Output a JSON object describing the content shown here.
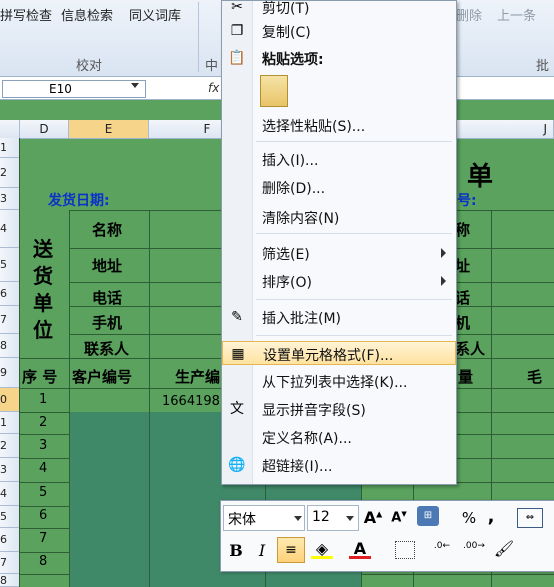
{
  "ribbon": {
    "items": [
      "拼写检查",
      "信息检索",
      "同义词库"
    ],
    "group_proofing": "校对",
    "group_partial": "中",
    "right_items": [
      "删除",
      "上一条"
    ],
    "right_group_partial": "批"
  },
  "formula_bar": {
    "name_box": "E10",
    "fx": "fx"
  },
  "columns": [
    "D",
    "E",
    "F",
    "J"
  ],
  "rows": [
    "1",
    "2",
    "3",
    "4",
    "5",
    "6",
    "7",
    "8",
    "9",
    "0",
    "1",
    "2",
    "3",
    "4",
    "5",
    "6",
    "7",
    "8",
    "9"
  ],
  "sheet": {
    "title_char": "单",
    "ship_date": "发货日期:",
    "right_header_partial": "号:",
    "vertical_label": [
      "送",
      "货",
      "单",
      "位"
    ],
    "fields": [
      "名称",
      "地址",
      "电话",
      "手机",
      "联系人"
    ],
    "right_fields": [
      "称",
      "址",
      "话",
      "机",
      "系人"
    ],
    "table_headers": [
      "序 号",
      "客户编号",
      "生产编"
    ],
    "right_table_headers": [
      "量",
      "毛"
    ],
    "serials": [
      "1",
      "2",
      "3",
      "4",
      "5",
      "6",
      "7",
      "8"
    ],
    "partial_value": "1664198"
  },
  "context_menu": {
    "items": [
      {
        "label": "剪切(T)",
        "icon": "scissors-icon"
      },
      {
        "label": "复制(C)",
        "icon": "copy-icon"
      },
      {
        "label": "粘贴选项:",
        "icon": "paste-icon",
        "bold": true
      },
      {
        "label": "",
        "icon": "paste-option-icon"
      },
      {
        "label": "选择性粘贴(S)...",
        "icon": ""
      },
      {
        "label": "插入(I)...",
        "icon": ""
      },
      {
        "label": "删除(D)...",
        "icon": ""
      },
      {
        "label": "清除内容(N)",
        "icon": ""
      },
      {
        "label": "筛选(E)",
        "icon": "",
        "submenu": true
      },
      {
        "label": "排序(O)",
        "icon": "",
        "submenu": true
      },
      {
        "label": "插入批注(M)",
        "icon": "comment-icon"
      },
      {
        "label": "设置单元格格式(F)...",
        "icon": "format-cells-icon",
        "highlighted": true
      },
      {
        "label": "从下拉列表中选择(K)...",
        "icon": ""
      },
      {
        "label": "显示拼音字段(S)",
        "icon": "phonetic-icon"
      },
      {
        "label": "定义名称(A)...",
        "icon": ""
      },
      {
        "label": "超链接(I)...",
        "icon": "hyperlink-icon"
      }
    ]
  },
  "mini_toolbar": {
    "font_name": "宋体",
    "font_size": "12",
    "buttons": [
      "increase-font-icon",
      "decrease-font-icon",
      "format-icon",
      "percent-icon",
      "comma-icon",
      "merge-icon",
      "bold-icon",
      "italic-icon",
      "align-center-icon",
      "fill-color-icon",
      "font-color-icon",
      "border-icon",
      "decrease-decimal-icon",
      "increase-decimal-icon",
      "format-painter-icon"
    ],
    "percent": "%",
    "comma": ",",
    "bold": "B",
    "italic": "I",
    "font_color": "A"
  },
  "colors": {
    "sheet_green": "#5aa25e",
    "teal_cells": "#3f8868",
    "header_blue": "#0a32c8",
    "menu_highlight": "#ffe2a0"
  }
}
